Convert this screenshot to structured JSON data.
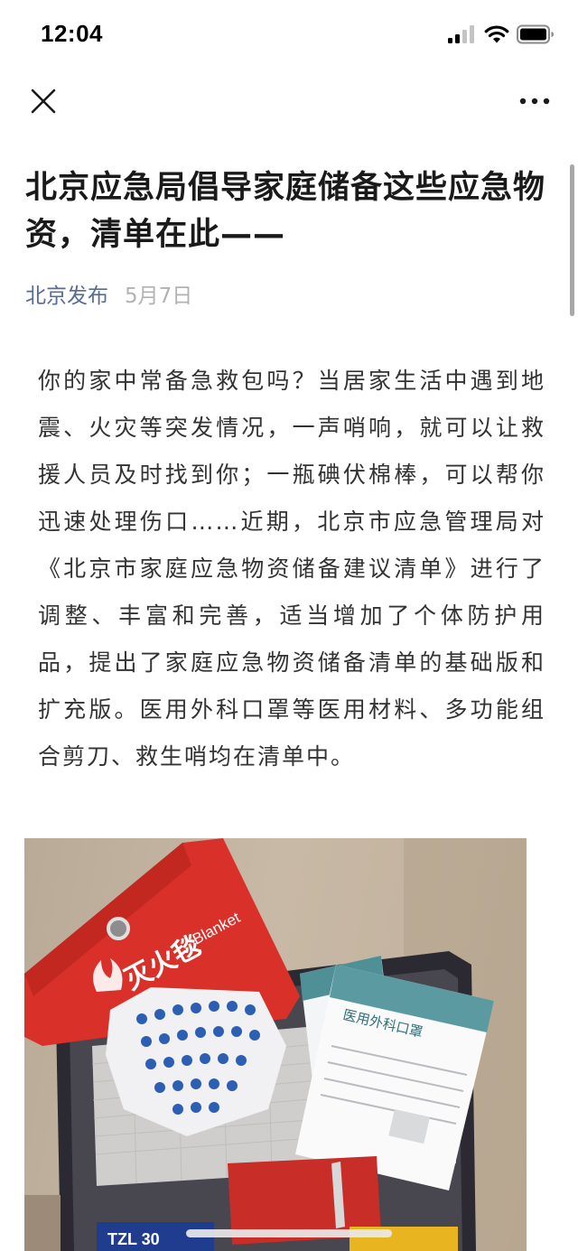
{
  "status_bar": {
    "time": "12:04",
    "icons": [
      "signal-icon",
      "wifi-icon",
      "battery-icon"
    ]
  },
  "nav": {
    "close_icon": "close-icon",
    "more_icon": "more-icon"
  },
  "article": {
    "title": "北京应急局倡导家庭储备这些应急物资，清单在此——",
    "author": "北京发布",
    "date": "5月7日",
    "body": "你的家中常备急救包吗？当居家生活中遇到地震、火灾等突发情况，一声哨响，就可以让救援人员及时找到你；一瓶碘伏棉棒，可以帮你迅速处理伤口……近期，北京市应急管理局对《北京市家庭应急物资储备建议清单》进行了调整、丰富和完善，适当增加了个体防护用品，提出了家庭应急物资储备清单的基础版和扩充版。医用外科口罩等医用材料、多功能组合剪刀、救生哨均在清单中。"
  },
  "photo": {
    "blanket_label": "灭火毯",
    "blanket_label_en": "Blanket",
    "mask_label": "医用外科口罩",
    "flashlight_label": "TZL 30"
  },
  "colors": {
    "author_link": "#576b95",
    "date": "#b2b2b2",
    "body_text": "#333333",
    "title_text": "#1a1a1a"
  }
}
